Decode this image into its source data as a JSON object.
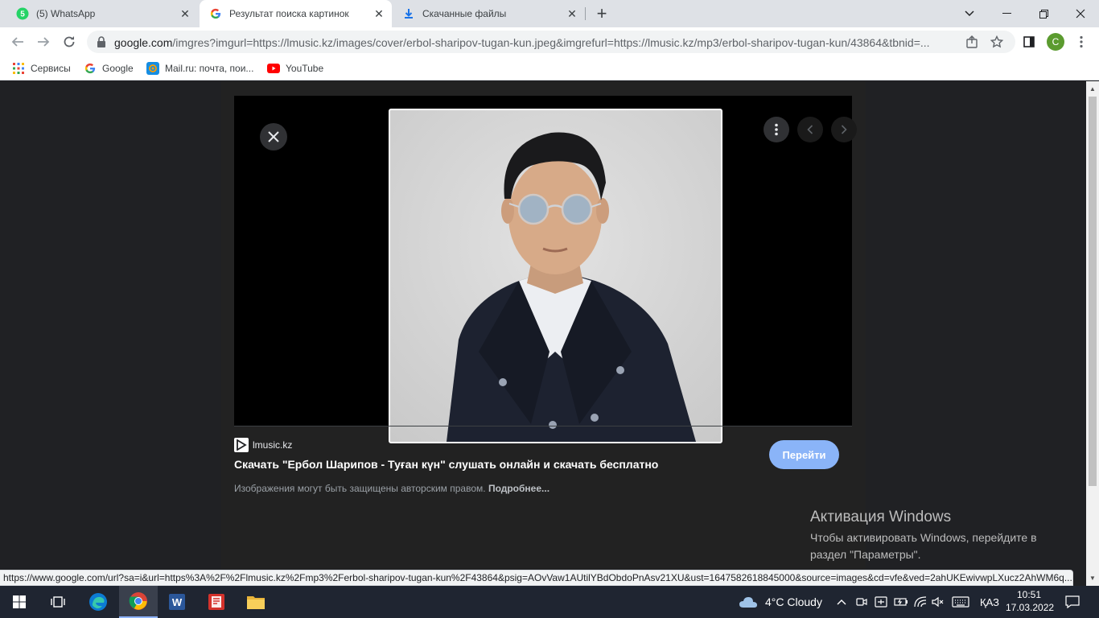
{
  "tabs": [
    {
      "title": "(5) WhatsApp",
      "icon": "whatsapp-icon",
      "badge": "5",
      "active": false
    },
    {
      "title": "Результат поиска картинок",
      "icon": "google-icon",
      "active": true
    },
    {
      "title": "Скачанные файлы",
      "icon": "download-icon",
      "active": false
    }
  ],
  "toolbar": {
    "url_host": "google.com",
    "url_rest": "/imgres?imgurl=https://lmusic.kz/images/cover/erbol-sharipov-tugan-kun.jpeg&imgrefurl=https://lmusic.kz/mp3/erbol-sharipov-tugan-kun/43864&tbnid=...",
    "profile_initial": "C"
  },
  "bookmarks": [
    {
      "label": "Сервисы",
      "icon": "apps-grid-icon"
    },
    {
      "label": "Google",
      "icon": "google-icon"
    },
    {
      "label": "Mail.ru: почта, пои...",
      "icon": "mailru-icon"
    },
    {
      "label": "YouTube",
      "icon": "youtube-icon"
    }
  ],
  "result": {
    "source": "lmusic.kz",
    "title": "Скачать \"Ербол Шарипов - Туған күн\" слушать онлайн и скачать бесплатно",
    "copyright_text": "Изображения могут быть защищены авторским правом.",
    "more_link": "Подробнее...",
    "go_button": "Перейти"
  },
  "activation": {
    "title": "Активация Windows",
    "text": "Чтобы активировать Windows, перейдите в раздел \"Параметры\"."
  },
  "status_url": "https://www.google.com/url?sa=i&url=https%3A%2F%2Flmusic.kz%2Fmp3%2Ferbol-sharipov-tugan-kun%2F43864&psig=AOvVaw1AUtilYBdObdoPnAsv21XU&ust=1647582618845000&source=images&cd=vfe&ved=2ahUKEwivwpLXucz2AhWM6q...",
  "taskbar": {
    "weather": "4°C  Cloudy",
    "language": "ҚАЗ",
    "time": "10:51",
    "date": "17.03.2022"
  },
  "colors": {
    "go_button": "#8ab4f8",
    "page_bg": "#202124",
    "taskbar": "#1f2531"
  }
}
